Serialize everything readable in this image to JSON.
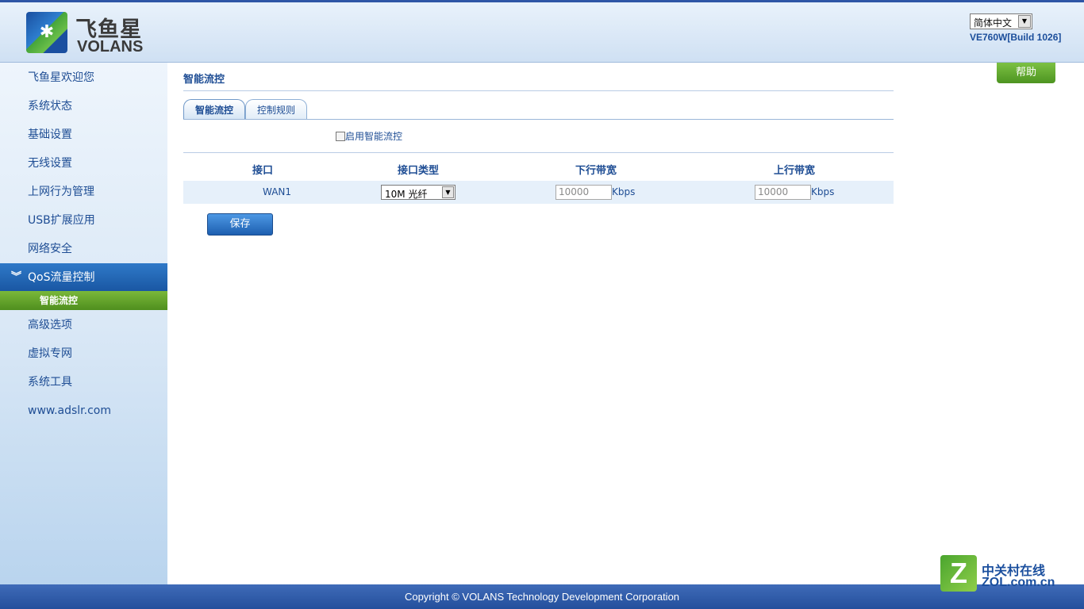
{
  "header": {
    "logo_cn": "飞鱼星",
    "logo_en": "VOLANS",
    "language": "简体中文",
    "version": "VE760W[Build 1026]"
  },
  "sidebar": {
    "items": [
      {
        "label": "飞鱼星欢迎您"
      },
      {
        "label": "系统状态"
      },
      {
        "label": "基础设置"
      },
      {
        "label": "无线设置"
      },
      {
        "label": "上网行为管理"
      },
      {
        "label": "USB扩展应用"
      },
      {
        "label": "网络安全"
      },
      {
        "label": "QoS流量控制"
      },
      {
        "label": "高级选项"
      },
      {
        "label": "虚拟专网"
      },
      {
        "label": "系统工具"
      },
      {
        "label": "www.adslr.com"
      }
    ],
    "active_sub": "智能流控"
  },
  "main": {
    "title": "智能流控",
    "help": "帮助",
    "tabs": [
      {
        "label": "智能流控"
      },
      {
        "label": "控制规则"
      }
    ],
    "enable_label": "启用智能流控",
    "table": {
      "headers": [
        "接口",
        "接口类型",
        "下行带宽",
        "上行带宽"
      ],
      "row": {
        "interface": "WAN1",
        "type": "10M 光纤",
        "down_placeholder": "10000",
        "up_placeholder": "10000",
        "unit": "Kbps"
      }
    },
    "save": "保存"
  },
  "footer": {
    "copyright": "Copyright © VOLANS Technology Development Corporation"
  },
  "watermark": {
    "cn": "中关村在线",
    "en": "ZOL.com.cn"
  }
}
